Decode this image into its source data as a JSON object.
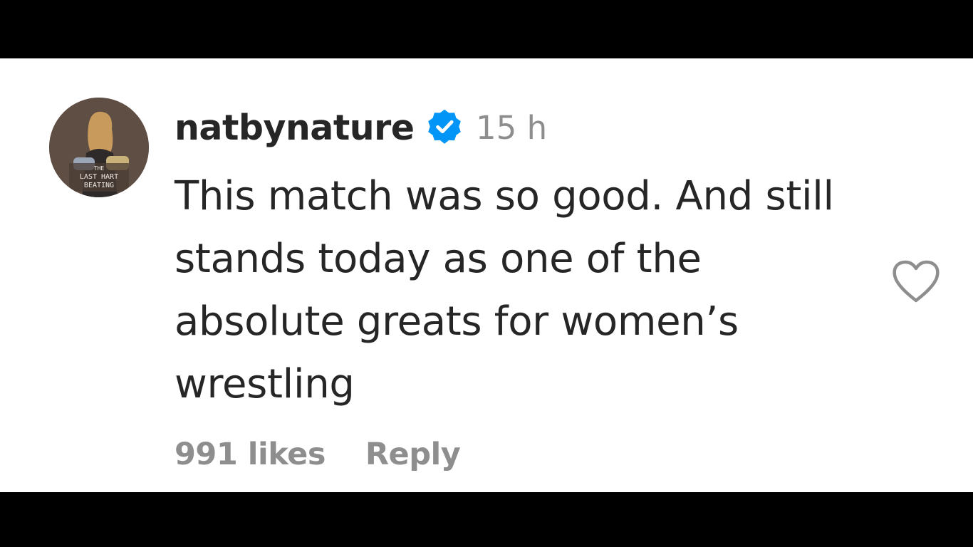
{
  "comment": {
    "username": "natbynature",
    "verified_icon": "verified-badge-icon",
    "timestamp": "15 h",
    "text": "This match was so good. And still stands today as one of the absolute greats for women’s wrestling",
    "likes": "991 likes",
    "reply_label": "Reply",
    "like_icon": "heart-outline-icon"
  },
  "avatar": {
    "text_line1": "THE",
    "text_line2": "LAST HART",
    "text_line3": "BEATING"
  },
  "colors": {
    "primary_text": "#262626",
    "secondary_text": "#8e8e8e",
    "verified_blue": "#0095f6",
    "background": "#ffffff",
    "letterbox": "#000000"
  }
}
